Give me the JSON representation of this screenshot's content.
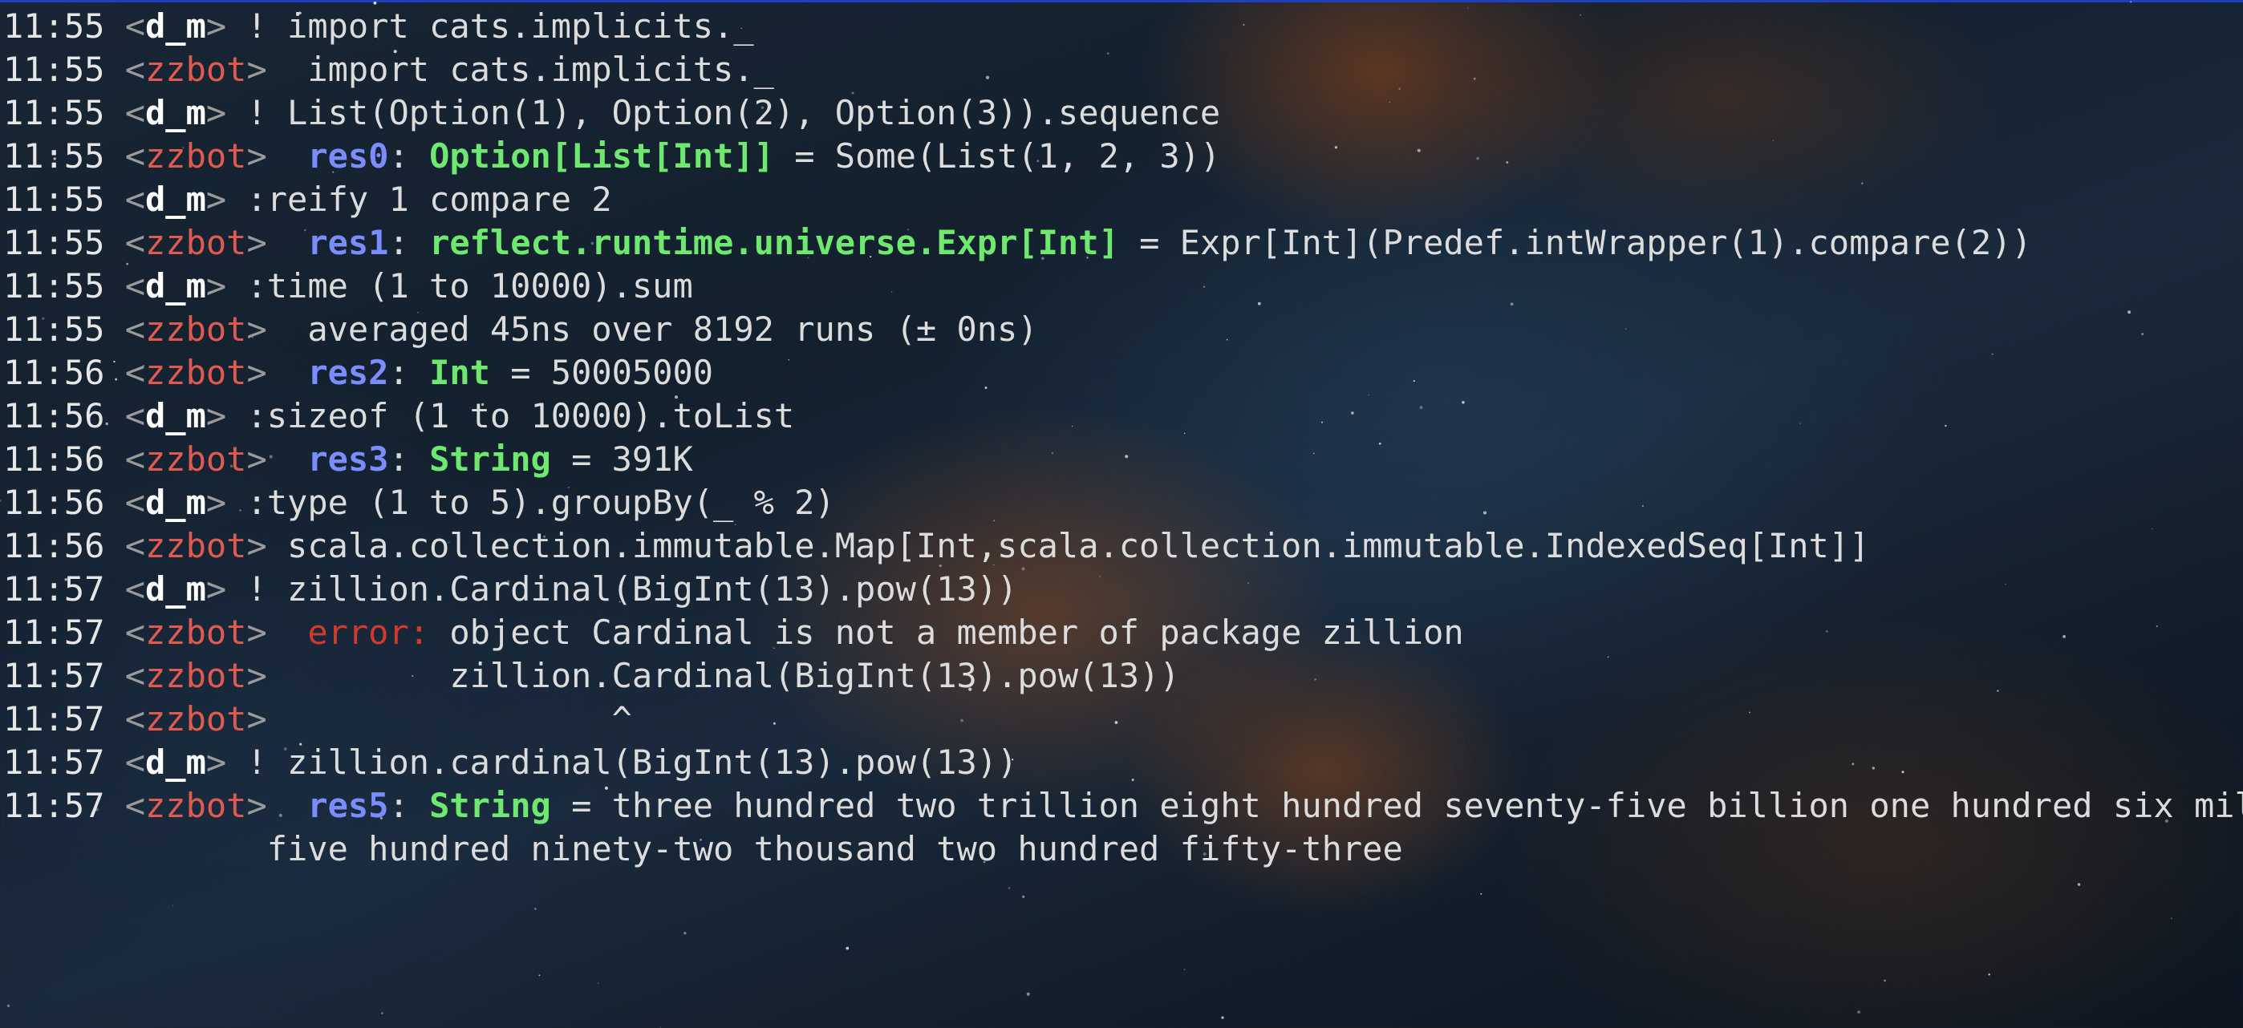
{
  "window": {
    "accent": "#1f3fbf",
    "background": "#15212e"
  },
  "nicks": {
    "user": "d_m",
    "bot": "zzbot"
  },
  "colors": {
    "user_nick": "#ffffff",
    "bot_nick": "#e05a4f",
    "result_name": "#7b8cff",
    "type_name": "#6ee86e",
    "error": "#d03a2c",
    "text": "#dcdcdc"
  },
  "messages": [
    {
      "time": "11:55",
      "nick": "d_m",
      "text": " ! import cats.implicits._"
    },
    {
      "time": "11:55",
      "nick": "zzbot",
      "text": "  import cats.implicits._"
    },
    {
      "time": "11:55",
      "nick": "d_m",
      "text": " ! List(Option(1), Option(2), Option(3)).sequence"
    },
    {
      "time": "11:55",
      "nick": "zzbot",
      "res": "res0",
      "type": "Option[List[Int]]",
      "text": " = Some(List(1, 2, 3))"
    },
    {
      "time": "11:55",
      "nick": "d_m",
      "text": " :reify 1 compare 2"
    },
    {
      "time": "11:55",
      "nick": "zzbot",
      "res": "res1",
      "type": "reflect.runtime.universe.Expr[Int]",
      "text": " = Expr[Int](Predef.intWrapper(1).compare(2))"
    },
    {
      "time": "11:55",
      "nick": "d_m",
      "text": " :time (1 to 10000).sum"
    },
    {
      "time": "11:55",
      "nick": "zzbot",
      "text": "  averaged 45ns over 8192 runs (± 0ns)"
    },
    {
      "time": "11:56",
      "nick": "zzbot",
      "res": "res2",
      "type": "Int",
      "text": " = 50005000"
    },
    {
      "time": "11:56",
      "nick": "d_m",
      "text": " :sizeof (1 to 10000).toList"
    },
    {
      "time": "11:56",
      "nick": "zzbot",
      "res": "res3",
      "type": "String",
      "text": " = 391K"
    },
    {
      "time": "11:56",
      "nick": "d_m",
      "text": " :type (1 to 5).groupBy(_ % 2)"
    },
    {
      "time": "11:56",
      "nick": "zzbot",
      "text": " scala.collection.immutable.Map[Int,scala.collection.immutable.IndexedSeq[Int]]"
    },
    {
      "time": "11:57",
      "nick": "d_m",
      "text": " ! zillion.Cardinal(BigInt(13).pow(13))"
    },
    {
      "time": "11:57",
      "nick": "zzbot",
      "error": "error:",
      "text": " object Cardinal is not a member of package zillion"
    },
    {
      "time": "11:57",
      "nick": "zzbot",
      "text": "         zillion.Cardinal(BigInt(13).pow(13))"
    },
    {
      "time": "11:57",
      "nick": "zzbot",
      "text": "                 ^"
    },
    {
      "time": "11:57",
      "nick": "d_m",
      "text": " ! zillion.cardinal(BigInt(13).pow(13))"
    },
    {
      "time": "11:57",
      "nick": "zzbot",
      "res": "res5",
      "type": "String",
      "text": " = three hundred two trillion eight hundred seventy-five billion one hundred six million"
    },
    {
      "time": "",
      "nick": "",
      "text": "five hundred ninety-two thousand two hundred fifty-three",
      "continuation": true
    }
  ]
}
